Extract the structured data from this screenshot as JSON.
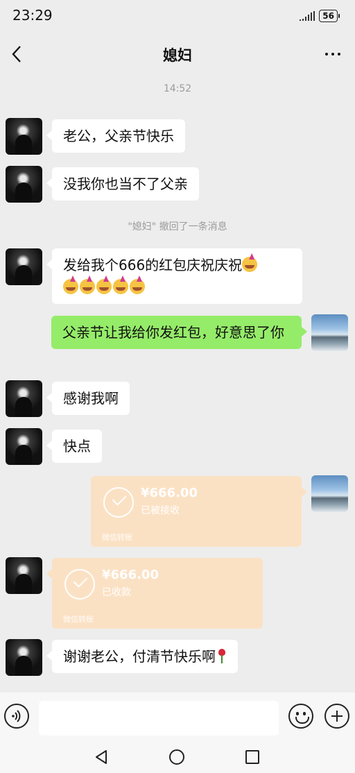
{
  "status_bar": {
    "time": "23:29",
    "battery": "56"
  },
  "header": {
    "title": "媳妇"
  },
  "timestamp": "14:52",
  "messages": {
    "m1": "老公，父亲节快乐",
    "m2": "没我你也当不了父亲",
    "recall": "\"媳妇\" 撤回了一条消息",
    "m3": "发给我个666的红包庆祝庆祝",
    "m4": "父亲节让我给你发红包，好意思了你",
    "m5": "感谢我啊",
    "m6": "快点",
    "m7": "谢谢老公，付清节快乐啊"
  },
  "transfers": {
    "sent": {
      "amount": "¥666.00",
      "status": "已被接收",
      "footer": "微信转账"
    },
    "received": {
      "amount": "¥666.00",
      "status": "已收款",
      "footer": "微信转账"
    }
  },
  "input": {
    "value": ""
  },
  "icons": [
    "back-icon",
    "more-icon",
    "voice-icon",
    "emoji-icon",
    "plus-icon",
    "nav-back-icon",
    "nav-home-icon",
    "nav-recent-icon"
  ],
  "colors": {
    "self_bubble": "#95ec69",
    "other_bubble": "#ffffff",
    "transfer": "#fbe1c4",
    "background": "#ededed"
  }
}
